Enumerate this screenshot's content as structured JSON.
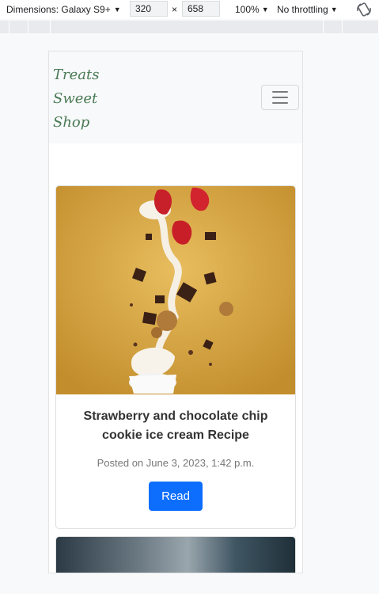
{
  "devtools": {
    "dimensions_label": "Dimensions: Galaxy S9+",
    "width_value": "320",
    "height_value": "658",
    "times": "×",
    "zoom": "100%",
    "throttling": "No throttling"
  },
  "navbar": {
    "brand_lines": [
      "Treats",
      "Sweet",
      "Shop"
    ]
  },
  "posts": [
    {
      "title": "Strawberry and chocolate chip cookie ice cream Recipe",
      "posted": "Posted on June 3, 2023, 1:42 p.m.",
      "button": "Read"
    }
  ],
  "colors": {
    "brand": "#4a7a55",
    "primary_button": "#0d6efd",
    "navbar_bg": "#f8f9fa",
    "photo_background": "#d9a94a"
  }
}
